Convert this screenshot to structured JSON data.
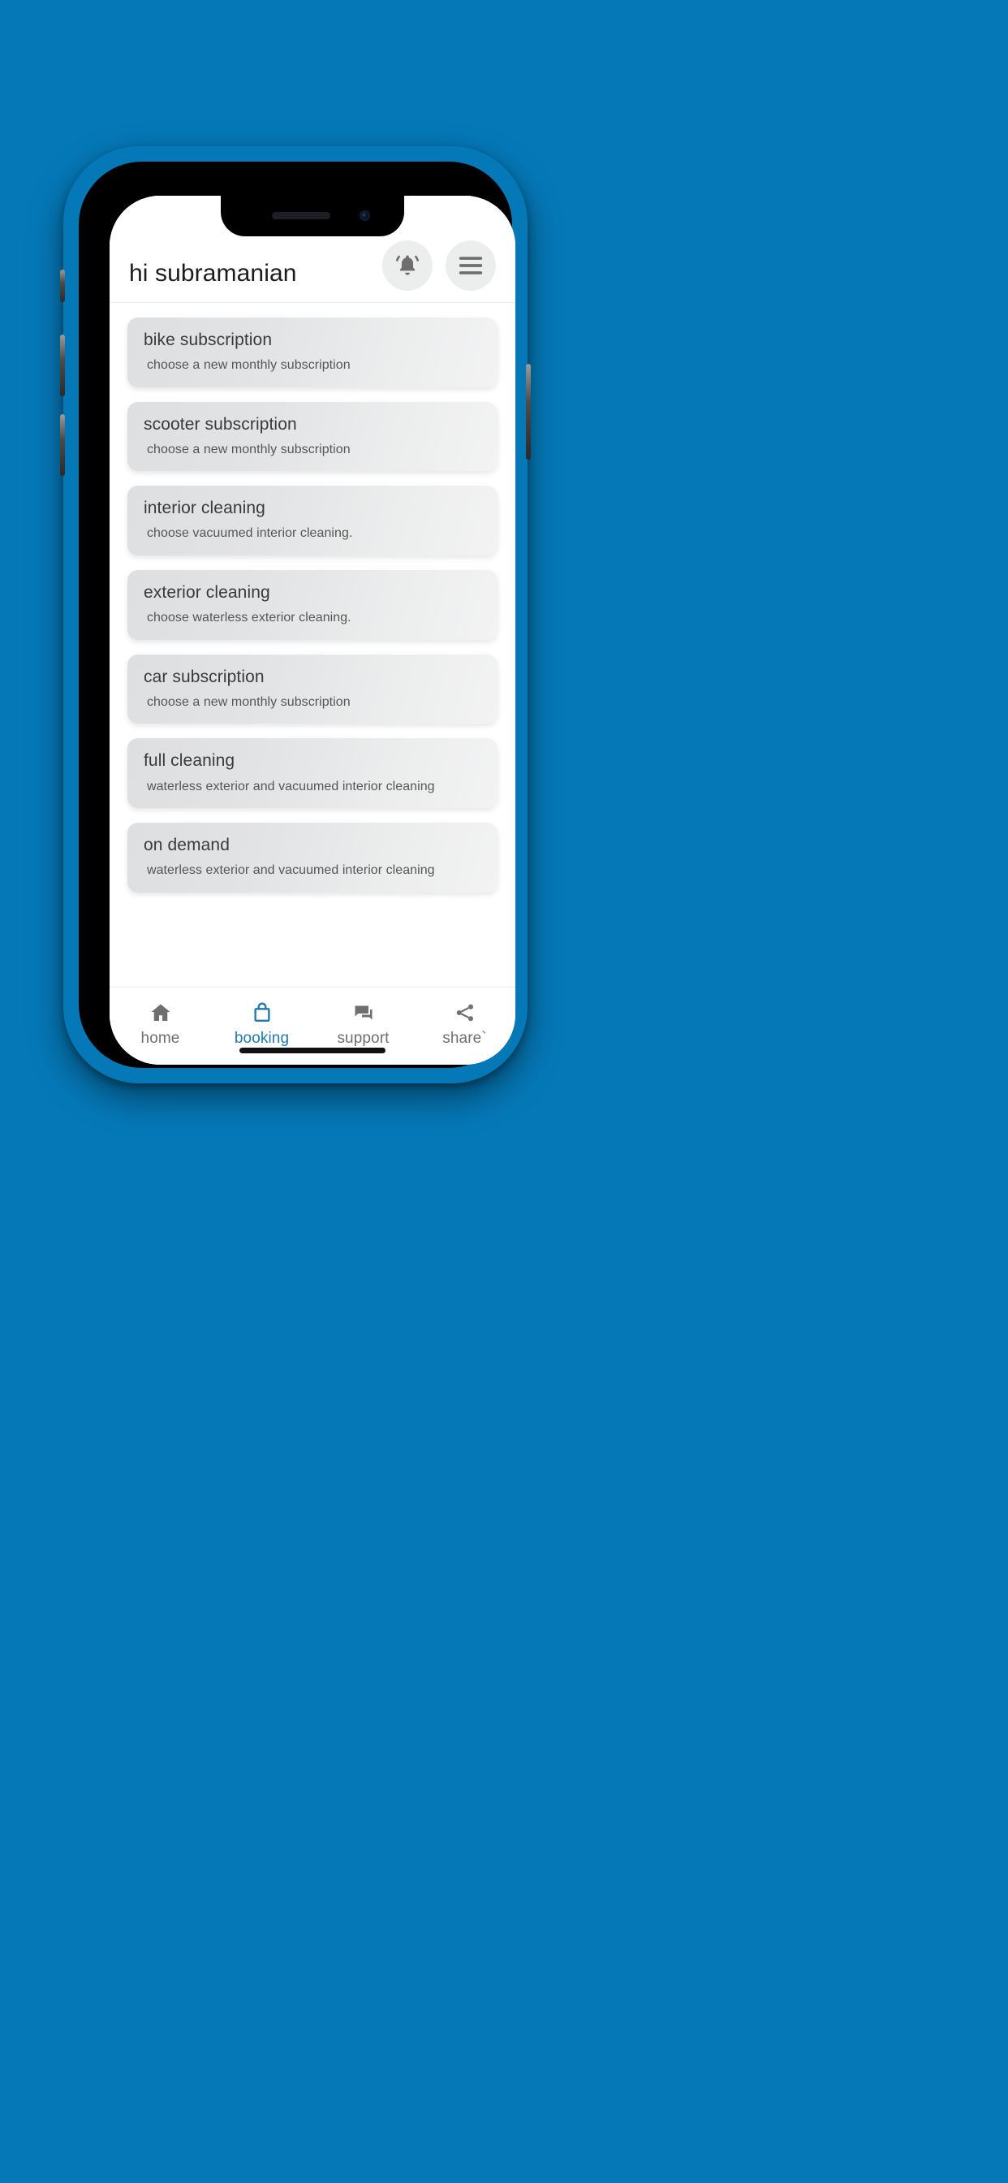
{
  "theme": {
    "background": "#0579b8",
    "accent": "#2079ad",
    "card_gradient_start": "#dedfe1",
    "card_gradient_end": "#f3f3f4",
    "text_primary": "#1c1c1c",
    "text_card_title": "#3a3a3a",
    "text_card_sub": "#565656",
    "nav_inactive": "#6f6f6f"
  },
  "appbar": {
    "greeting": "hi subramanian",
    "notifications_icon": "bell-icon",
    "menu_icon": "hamburger-menu-icon"
  },
  "cards": [
    {
      "title": "bike subscription",
      "subtitle": "choose a new monthly subscription"
    },
    {
      "title": "scooter subscription",
      "subtitle": "choose a new monthly subscription"
    },
    {
      "title": "interior cleaning",
      "subtitle": "choose vacuumed interior cleaning."
    },
    {
      "title": "exterior cleaning",
      "subtitle": "choose waterless exterior cleaning."
    },
    {
      "title": "car subscription",
      "subtitle": "choose a new monthly subscription"
    },
    {
      "title": "full cleaning",
      "subtitle": "waterless exterior and vacuumed interior cleaning"
    },
    {
      "title": "on demand",
      "subtitle": "waterless exterior and vacuumed interior cleaning"
    }
  ],
  "bottom_nav": {
    "items": [
      {
        "label": "home",
        "icon": "home-icon",
        "active": false
      },
      {
        "label": "booking",
        "icon": "shopping-bag-icon",
        "active": true
      },
      {
        "label": "support",
        "icon": "chat-bubbles-icon",
        "active": false
      },
      {
        "label": "share`",
        "icon": "share-nodes-icon",
        "active": false
      }
    ]
  }
}
